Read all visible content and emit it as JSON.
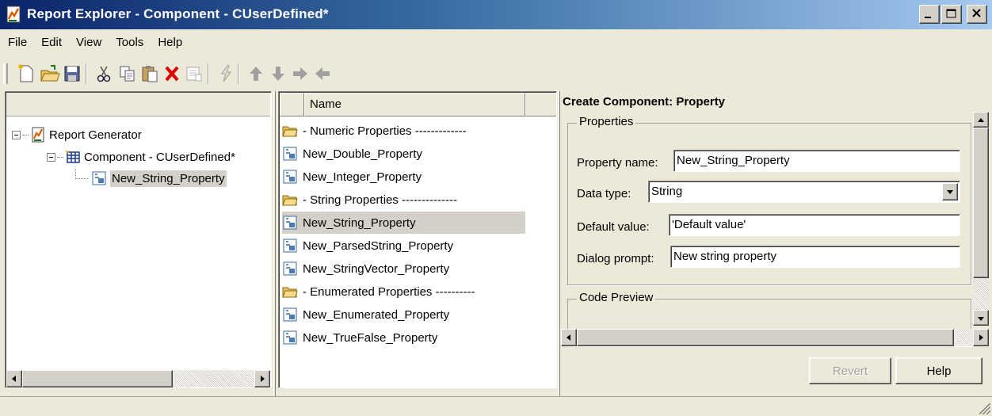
{
  "window": {
    "title": "Report Explorer - Component - CUserDefined*"
  },
  "menu": [
    "File",
    "Edit",
    "View",
    "Tools",
    "Help"
  ],
  "toolbar": {
    "icons": [
      "new-file-icon",
      "open-folder-icon",
      "save-icon",
      "cut-icon",
      "copy-icon",
      "paste-icon",
      "delete-icon",
      "properties-icon",
      "run-report-icon",
      "move-up-icon",
      "move-down-icon",
      "move-right-icon",
      "move-left-icon"
    ]
  },
  "tree": {
    "items": [
      {
        "label": "Report Generator",
        "icon": "report-generator-icon",
        "level": 0
      },
      {
        "label": "Component - CUserDefined*",
        "icon": "table-icon",
        "level": 1
      },
      {
        "label": "New_String_Property",
        "icon": "property-icon",
        "level": 2,
        "selected": true
      }
    ]
  },
  "list": {
    "header": "Name",
    "items": [
      {
        "label": "- Numeric Properties -------------",
        "icon": "folder-icon"
      },
      {
        "label": "New_Double_Property",
        "icon": "property-icon"
      },
      {
        "label": "New_Integer_Property",
        "icon": "property-icon"
      },
      {
        "label": "- String Properties --------------",
        "icon": "folder-icon"
      },
      {
        "label": "New_String_Property",
        "icon": "property-icon",
        "selected": true
      },
      {
        "label": "New_ParsedString_Property",
        "icon": "property-icon"
      },
      {
        "label": "New_StringVector_Property",
        "icon": "property-icon"
      },
      {
        "label": "- Enumerated Properties ----------",
        "icon": "folder-icon"
      },
      {
        "label": "New_Enumerated_Property",
        "icon": "property-icon"
      },
      {
        "label": "New_TrueFalse_Property",
        "icon": "property-icon"
      }
    ]
  },
  "detail": {
    "title": "Create Component: Property",
    "properties_group": "Properties",
    "property_name_label": "Property name:",
    "property_name_value": "New_String_Property",
    "data_type_label": "Data type:",
    "data_type_value": "String",
    "default_value_label": "Default value:",
    "default_value_value": "'Default value'",
    "dialog_prompt_label": "Dialog prompt:",
    "dialog_prompt_value": "New string property",
    "code_preview_group": "Code Preview",
    "revert_label": "Revert",
    "help_label": "Help"
  },
  "colors": {
    "title_bar_start": "#0a246a",
    "title_bar_end": "#a6caf0",
    "window_bg": "#ece9d8",
    "selection_bg": "#d4d0c8"
  }
}
